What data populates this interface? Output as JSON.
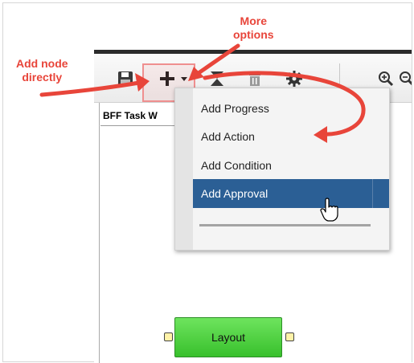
{
  "annotations": {
    "add_node": {
      "line1": "Add node",
      "line2": "directly"
    },
    "more_options": {
      "line1": "More",
      "line2": "options"
    },
    "color": "#e8453a"
  },
  "toolbar": {
    "icons": [
      "save-icon",
      "add-icon",
      "dropdown-arrow-icon",
      "hourglass-icon",
      "trash-icon",
      "gear-icon",
      "zoom-in-icon",
      "zoom-out-icon"
    ]
  },
  "canvas": {
    "tab_label": "BFF Task W"
  },
  "context_menu": {
    "items": [
      {
        "label": "Add Progress"
      },
      {
        "label": "Add Action"
      },
      {
        "label": "Add Condition"
      },
      {
        "label": "Add Approval",
        "hovered": true
      }
    ],
    "highlight_color": "#2b5f95"
  },
  "node": {
    "label": "Layout",
    "color": "#4fd441"
  }
}
